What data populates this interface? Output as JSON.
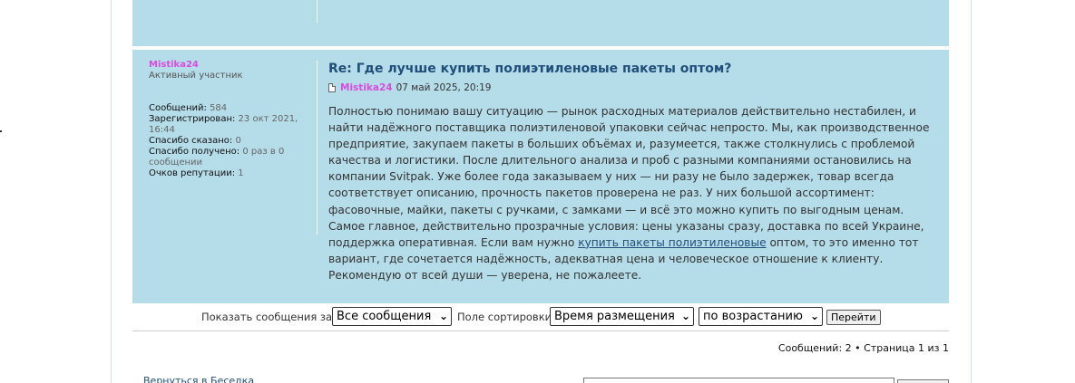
{
  "previous_post": {},
  "post": {
    "author": "Mistika24",
    "rank": "Активный участник",
    "stats": [
      {
        "label": "Сообщений:",
        "value": "584"
      },
      {
        "label": "Зарегистрирован:",
        "value": "23 окт 2021, 16:44"
      },
      {
        "label": "Спасибо сказано:",
        "value": "0"
      },
      {
        "label": "Спасибо получено:",
        "value": "0 раз в 0 сообщении"
      },
      {
        "label": "Очков репутации:",
        "value": "1"
      }
    ],
    "title": "Re: Где лучше купить полиэтиленовые пакеты оптом?",
    "meta_author": "Mistika24",
    "date": "07 май 2025, 20:19",
    "body_before_link": "Полностью понимаю вашу ситуацию — рынок расходных материалов действительно нестабилен, и найти надёжного поставщика полиэтиленовой упаковки сейчас непросто. Мы, как производственное предприятие, закупаем пакеты в больших объёмах и, разумеется, также столкнулись с проблемой качества и логистики. После длительного анализа и проб с разными компаниями остановились на компании Svitpak. Уже более года заказываем у них — ни разу не было задержек, товар всегда соответствует описанию, прочность пакетов проверена не раз. У них большой ассортимент: фасовочные, майки, пакеты с ручками, с замками — и всё это можно купить по выгодным ценам. Самое главное, действительно прозрачные условия: цены указаны сразу, доставка по всей Украине, поддержка оперативная. Если вам нужно ",
    "link_text": "купить пакеты полиэтиленовые",
    "body_after_link": " оптом, то это именно тот вариант, где сочетается надёжность, адекватная цена и человеческое отношение к клиенту. Рекомендую от всей души — уверена, не пожалеете."
  },
  "sort_bar": {
    "show_label": "Показать сообщения за:",
    "show_value": "Все сообщения",
    "sort_label": "Поле сортировки",
    "sort_value": "Время размещения",
    "order_value": "по возрастанию",
    "go_button": "Перейти"
  },
  "pagination": {
    "text": "Сообщений: 2 • Страница 1 из 1"
  },
  "footer": {
    "back_link": "Вернуться в Беседка"
  },
  "colors": {
    "post_bg": "#b5dce9",
    "author": "#d94ce0",
    "title": "#1f4e79"
  }
}
